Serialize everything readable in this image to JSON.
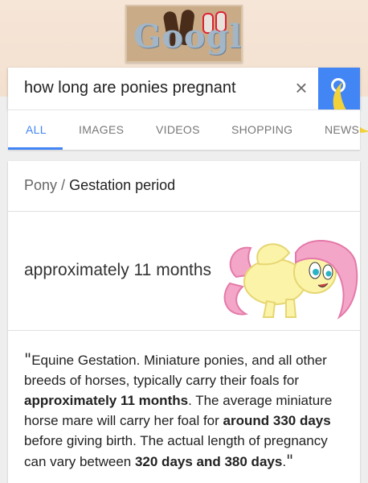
{
  "header": {
    "doodle_text": "Google",
    "colors": {
      "background": "#f6e6d8",
      "accent": "#4285f4"
    }
  },
  "search": {
    "query": "how long are ponies pregnant",
    "clear_icon": "close-icon",
    "submit_icon": "search-icon"
  },
  "tabs": [
    {
      "label": "ALL",
      "active": true
    },
    {
      "label": "IMAGES",
      "active": false
    },
    {
      "label": "VIDEOS",
      "active": false
    },
    {
      "label": "SHOPPING",
      "active": false
    },
    {
      "label": "NEWS",
      "active": false
    }
  ],
  "result": {
    "breadcrumb_entity": "Pony",
    "breadcrumb_separator": "/",
    "breadcrumb_attribute": "Gestation period",
    "answer": "approximately 11 months",
    "snippet": {
      "open_quote": "\"",
      "p1": "Equine Gestation. Miniature ponies, and all other breeds of horses, typically carry their foals for ",
      "b1": "approximately 11 months",
      "p2": ". The average miniature horse mare will carry her foal for ",
      "b2": "around 330 days",
      "p3": " before giving birth. The actual length of pregnancy can vary between ",
      "b3": "320 days and 380 days",
      "p4": ".",
      "close_quote": "\""
    }
  }
}
